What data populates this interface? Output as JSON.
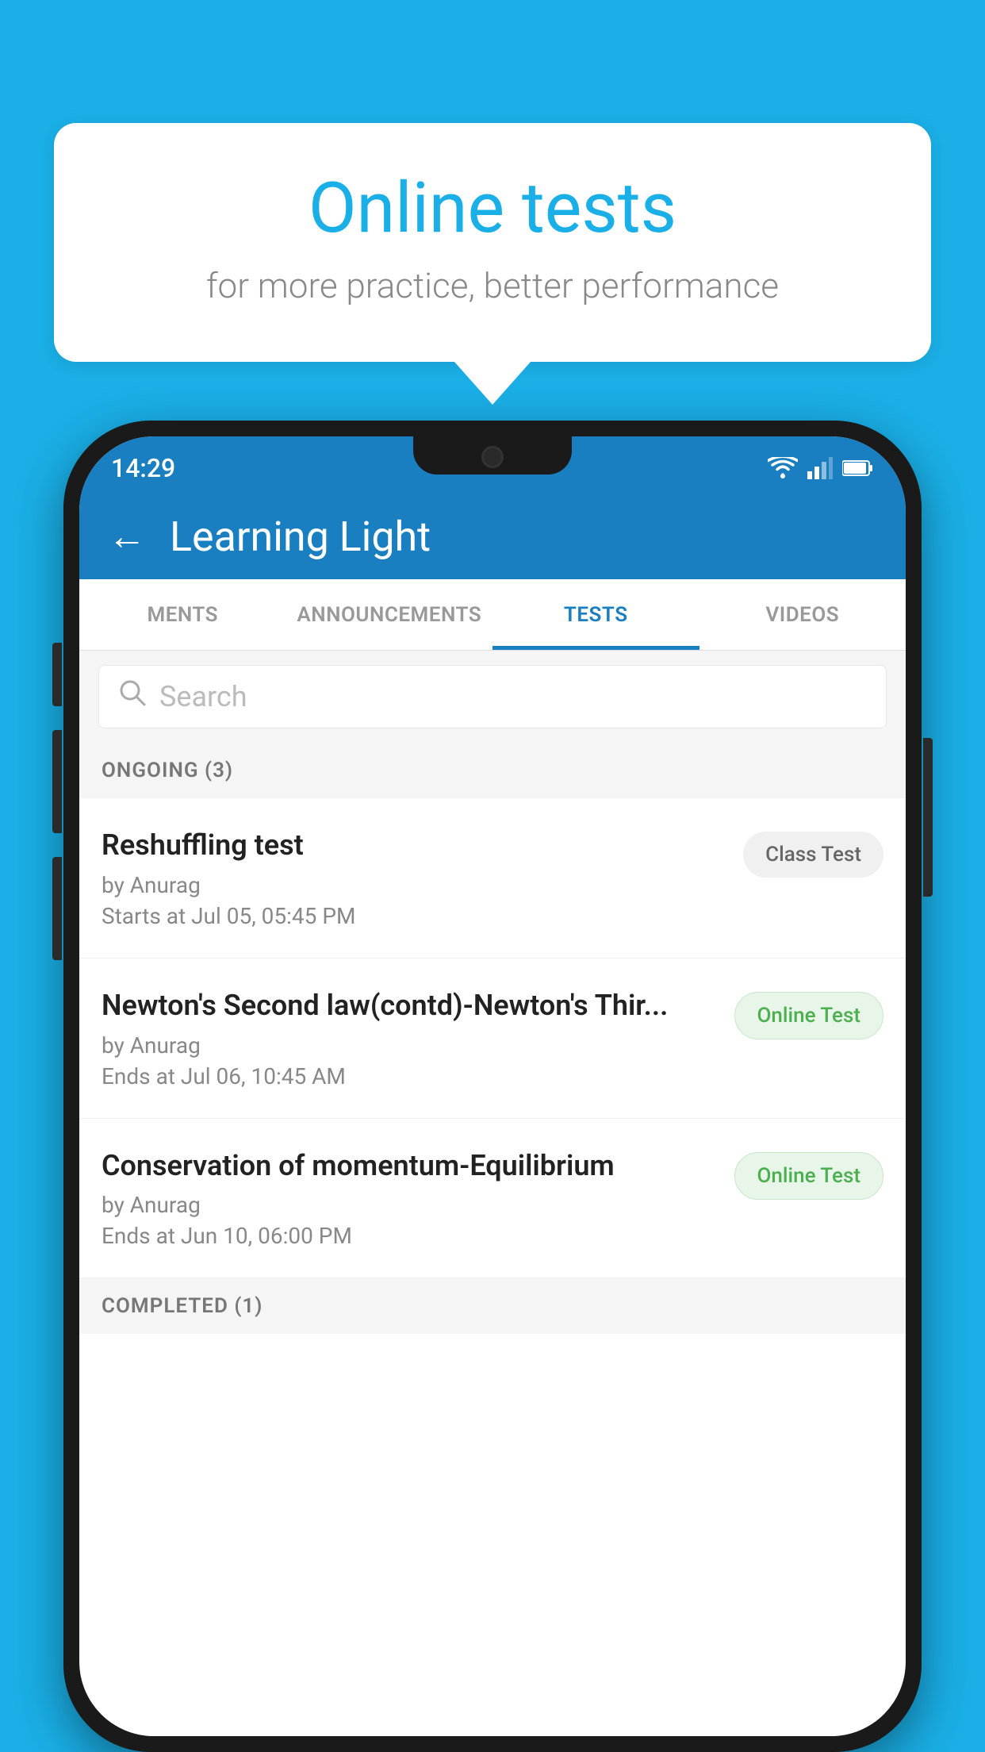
{
  "background": {
    "color": "#1AAFE6"
  },
  "speech_bubble": {
    "title": "Online tests",
    "subtitle": "for more practice, better performance"
  },
  "phone": {
    "status_bar": {
      "time": "14:29",
      "wifi_icon": "▾",
      "signal_icon": "◂",
      "battery_icon": "▮"
    },
    "header": {
      "back_label": "←",
      "title": "Learning Light"
    },
    "tabs": [
      {
        "label": "MENTS",
        "active": false
      },
      {
        "label": "ANNOUNCEMENTS",
        "active": false
      },
      {
        "label": "TESTS",
        "active": true
      },
      {
        "label": "VIDEOS",
        "active": false
      }
    ],
    "search": {
      "placeholder": "Search"
    },
    "sections": [
      {
        "label": "ONGOING (3)",
        "tests": [
          {
            "name": "Reshuffling test",
            "author": "by Anurag",
            "date": "Starts at  Jul 05, 05:45 PM",
            "badge": "Class Test",
            "badge_type": "class"
          },
          {
            "name": "Newton's Second law(contd)-Newton's Thir...",
            "author": "by Anurag",
            "date": "Ends at  Jul 06, 10:45 AM",
            "badge": "Online Test",
            "badge_type": "online"
          },
          {
            "name": "Conservation of momentum-Equilibrium",
            "author": "by Anurag",
            "date": "Ends at  Jun 10, 06:00 PM",
            "badge": "Online Test",
            "badge_type": "online"
          }
        ]
      }
    ],
    "completed_label": "COMPLETED (1)"
  }
}
